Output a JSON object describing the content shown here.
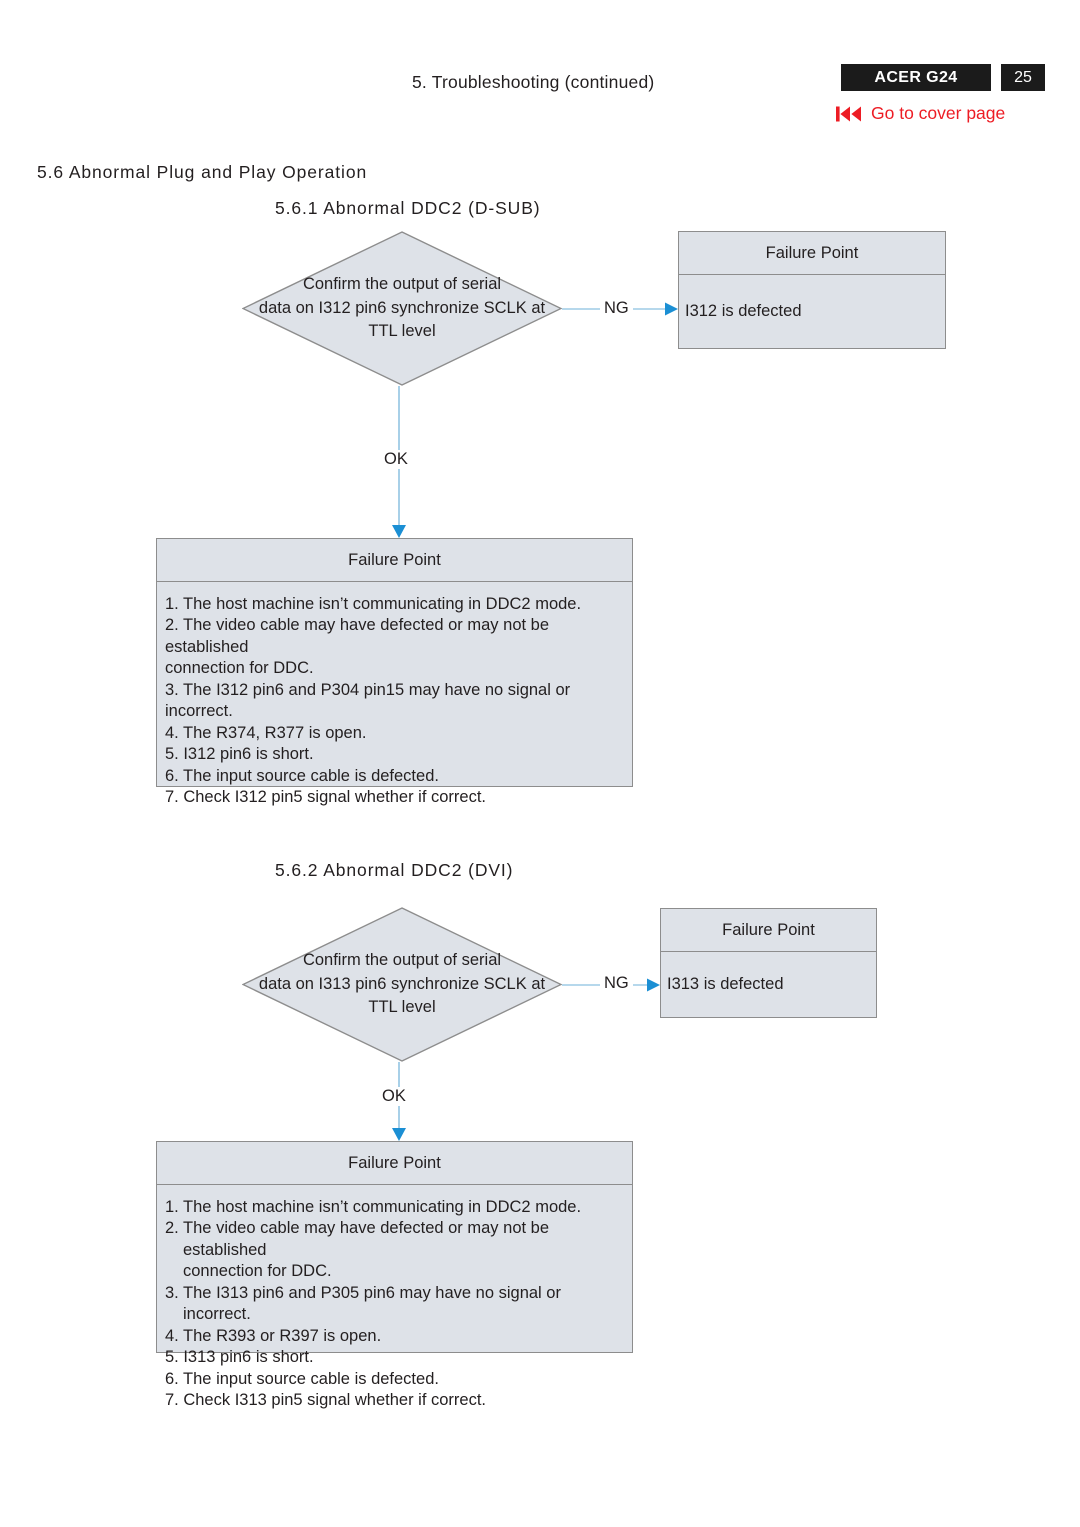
{
  "header": {
    "title": "5. Troubleshooting (continued)",
    "model_badge": "ACER G24",
    "page_badge": "25",
    "cover_link": "Go to cover page",
    "cover_link_icon": "skip-to-start-icon",
    "badge_color": "#1b1b1b",
    "link_color": "#ed1c24"
  },
  "sections": {
    "main_heading": "5.6  Abnormal Plug and Play Operation",
    "sub1_heading": "5.6.1 Abnormal DDC2 (D-SUB)",
    "sub2_heading": "5.6.2 Abnormal DDC2 (DVI)"
  },
  "flow1": {
    "decision": {
      "line1": "Confirm the output of serial",
      "line2": "data on I312 pin6 synchronize SCLK at",
      "line3": "TTL level"
    },
    "ng_label": "NG",
    "ok_label": "OK",
    "ng_box": {
      "header": "Failure Point",
      "body": "I312 is defected"
    },
    "failure_box": {
      "header": "Failure Point",
      "items": [
        "1. The host machine isn’t communicating in DDC2 mode.",
        "2. The video cable may have defected or may not be established\nconnection for DDC.",
        "3. The I312 pin6 and P304 pin15 may have no signal or incorrect.",
        "4. The R374, R377 is open.",
        "5. I312 pin6 is short.",
        "6. The input source cable is defected.",
        "7. Check I312 pin5 signal whether if correct."
      ]
    }
  },
  "flow2": {
    "decision": {
      "line1": "Confirm the output of serial",
      "line2": "data on I313 pin6 synchronize SCLK at",
      "line3": "TTL level"
    },
    "ng_label": "NG",
    "ok_label": "OK",
    "ng_box": {
      "header": "Failure Point",
      "body": "I313 is defected"
    },
    "failure_box": {
      "header": "Failure Point",
      "items": [
        "1. The host machine isn’t communicating in DDC2 mode.",
        "2. The video cable may have defected or may not be established\nconnection for DDC.",
        "3. The I313 pin6 and P305 pin6 may have no signal or incorrect.",
        "4. The R393 or R397 is open.",
        "5. I313 pin6 is short.",
        "6. The input source cable is defected.",
        "7. Check I313 pin5 signal whether if correct."
      ]
    }
  },
  "style": {
    "box_fill": "#dee2e8",
    "box_border": "#8d8d8d",
    "connector_line": "#9ecbe6",
    "connector_arrow": "#1b8fd4"
  }
}
